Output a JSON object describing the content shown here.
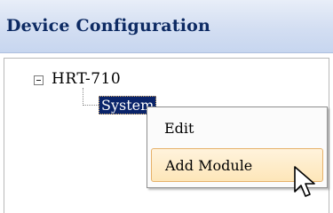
{
  "window": {
    "title": "Device Configuration"
  },
  "tree": {
    "root_label": "HRT-710",
    "root_expanded": true,
    "child_label": "System"
  },
  "context_menu": {
    "items": [
      {
        "label": "Edit",
        "highlighted": false
      },
      {
        "label": "Add Module",
        "highlighted": true
      }
    ]
  },
  "colors": {
    "title_text": "#0d2a63",
    "selection_bg": "#0a246a",
    "menu_highlight": "#fde6b9",
    "menu_highlight_border": "#e6b16a"
  },
  "icons": {
    "expander": "collapse-minus-icon",
    "cursor": "mouse-pointer-icon"
  }
}
